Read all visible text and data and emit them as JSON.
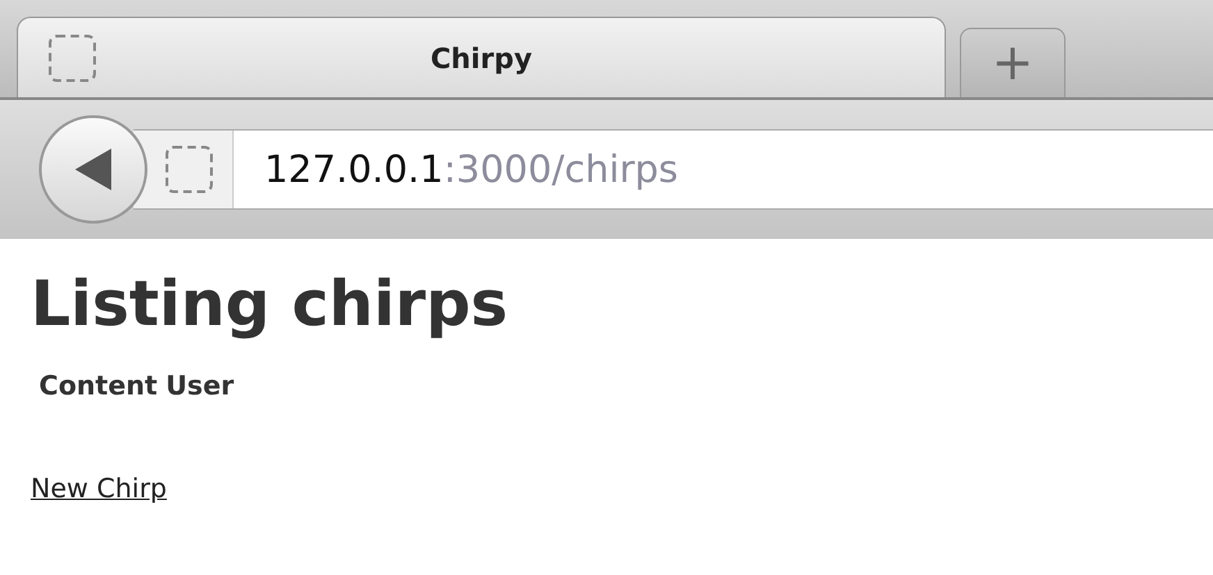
{
  "tabs": [
    {
      "title": "Chirpy",
      "selected": true
    }
  ],
  "new_tab_button": "+",
  "address_bar": {
    "host": "127.0.0.1",
    "path": ":3000/chirps"
  },
  "page": {
    "heading": "Listing chirps",
    "table": {
      "columns": [
        "Content",
        "User"
      ]
    },
    "link": "New Chirp"
  }
}
